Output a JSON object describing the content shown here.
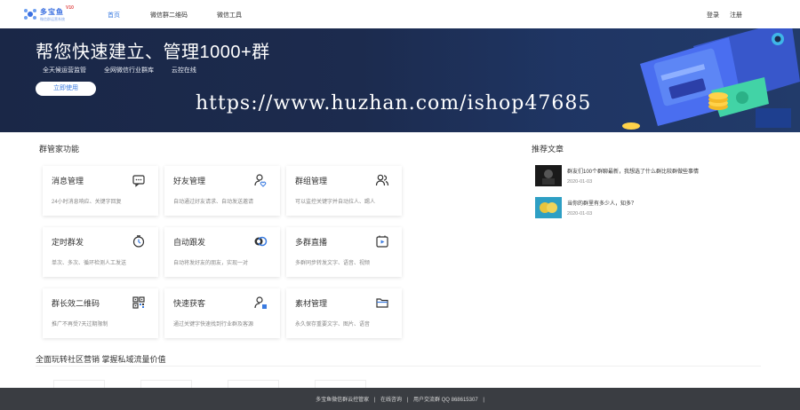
{
  "brand": {
    "name": "多宝鱼",
    "version": "V10",
    "tagline": "微信群运营系统"
  },
  "nav": {
    "items": [
      "首页",
      "微信群二维码",
      "微信工具"
    ],
    "login": "登录",
    "register": "注册"
  },
  "banner": {
    "title": "帮您快速建立、管理1000+群",
    "tags": [
      "全天候运营监管",
      "全网微信行业群库",
      "云控在线"
    ],
    "cta": "立即使用",
    "watermark": "https://www.huzhan.com/ishop47685"
  },
  "features": {
    "title": "群管家功能",
    "cards": [
      {
        "title": "消息管理",
        "desc": "24小时消息响应、关键字回复",
        "icon": "chat-icon"
      },
      {
        "title": "好友管理",
        "desc": "自动通过好友请求、自动发送邀请",
        "icon": "user-heart-icon"
      },
      {
        "title": "群组管理",
        "desc": "可以监控关键字并自动拉人、踢人",
        "icon": "users-icon"
      },
      {
        "title": "定时群发",
        "desc": "单次、多次、循环检测人工发送",
        "icon": "clock-icon"
      },
      {
        "title": "自动跟发",
        "desc": "自动将发好友的朋友，实现一对",
        "icon": "toggle-icon"
      },
      {
        "title": "多群直播",
        "desc": "多群同步转发文字、语音、视频",
        "icon": "play-icon"
      },
      {
        "title": "群长效二维码",
        "desc": "推广不再受7天过期限制",
        "icon": "qrcode-icon"
      },
      {
        "title": "快速获客",
        "desc": "通过关键字快速找到行业群及客源",
        "icon": "user-search-icon"
      },
      {
        "title": "素材管理",
        "desc": "永久保存重要文字、图片、语音",
        "icon": "folder-icon"
      }
    ]
  },
  "ranking": {
    "title": "推荐文章",
    "items": [
      {
        "title": "群友们100个群聊最新，我想选了什么群比较群做些事情",
        "date": "2020-01-03"
      },
      {
        "title": "当你的群里有多少人，知多？",
        "date": "2020-01-03"
      }
    ]
  },
  "bottom": {
    "title": "全面玩转社区营销 掌握私域流量价值"
  },
  "footer": {
    "brand": "多宝鱼微信群云控管家",
    "sep": "|",
    "site": "在线咨询",
    "support": "用户交流群 QQ 868615307"
  },
  "colors": {
    "accent": "#3a7be0",
    "bannerBg": "#1c2b4e",
    "footerBg": "#3a3d42"
  }
}
